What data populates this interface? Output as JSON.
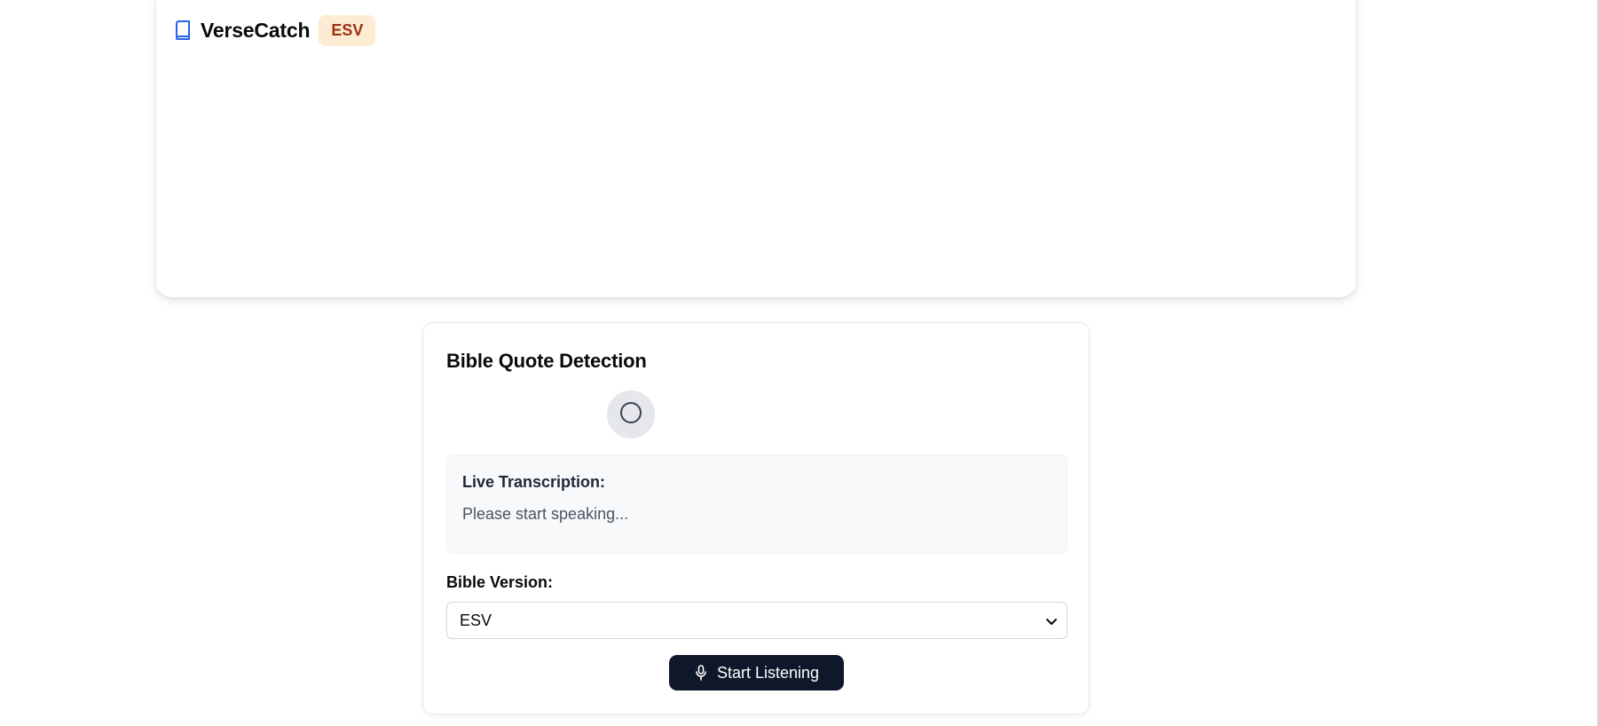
{
  "header": {
    "app_title": "VerseCatch",
    "version_badge": "ESV",
    "icon": "book-icon"
  },
  "detection_card": {
    "title": "Bible Quote Detection",
    "status_icon": "circle-icon",
    "transcription": {
      "label": "Live Transcription:",
      "text": "Please start speaking..."
    },
    "version_label": "Bible Version:",
    "version_select": {
      "selected": "ESV",
      "icon": "chevron-down-icon"
    },
    "start_button": {
      "label": "Start Listening",
      "icon": "mic-icon"
    }
  },
  "colors": {
    "brand_icon": "#2563eb",
    "badge_bg": "#fdecd3",
    "badge_text": "#9a3412",
    "button_bg": "#0f172a",
    "button_text": "#ffffff",
    "status_circle_bg": "#e5e7eb"
  }
}
